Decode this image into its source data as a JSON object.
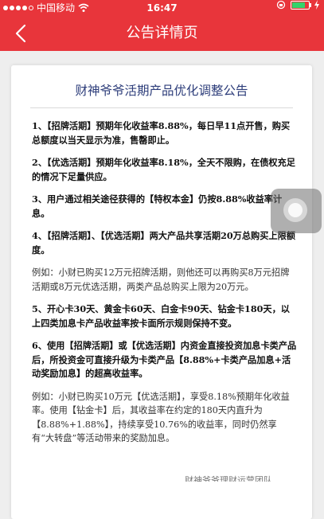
{
  "status_bar": {
    "carrier": "中国移动",
    "time": "16:47",
    "battery_level": 0.8,
    "battery_color": "#33d36b"
  },
  "nav": {
    "title": "公告详情页",
    "back_icon": "chevron-left-icon",
    "background_color": "#e8353b"
  },
  "notice": {
    "title": "财神爷爷活期产品优化调整公告",
    "paragraphs": [
      {
        "type": "item",
        "text": "1、【招牌活期】预期年化收益率8.88%，每日早11点开售，购买总额度以当天显示为准，售罄即止。"
      },
      {
        "type": "item",
        "text": "2、【优选活期】预期年化收益率8.18%，全天不限购，在债权充足的情况下足量供应。"
      },
      {
        "type": "item",
        "text": "3、用户通过相关途径获得的【特权本金】仍按8.88%收益率计息。"
      },
      {
        "type": "item",
        "text": "4、【招牌活期】、【优选活期】两大产品共享活期20万总购买上限额度。"
      },
      {
        "type": "example",
        "text": "例如：小财已购买12万元招牌活期，则他还可以再购买8万元招牌活期或8万元优选活期，两类产品总购买上限为20万元。"
      },
      {
        "type": "item",
        "text": "5、开心卡30天、黄金卡60天、白金卡90天、钻金卡180天，以上四类加息卡产品收益率按卡面所示规则保持不变。"
      },
      {
        "type": "item",
        "text": "6、使用【招牌活期】或【优选活期】内资金直接投资加息卡类产品后，所投资金可直接升级为卡类产品【8.88%+卡类产品加息+活动奖励加息】的超高收益率。"
      },
      {
        "type": "example",
        "text": "例如：小财已购买10万元【优选活期】，享受8.18%预期年化收益率。使用【钻金卡】后，其收益率在约定的180天内直升为【8.88%+1.88%】，持续享受10.76%的收益率，同时仍然享有“大转盘”等活动带来的奖励加息。"
      }
    ],
    "footer_partial": "财神爷爷理财运营团队"
  },
  "floating_button": {
    "icon": "assistive-touch-icon"
  }
}
